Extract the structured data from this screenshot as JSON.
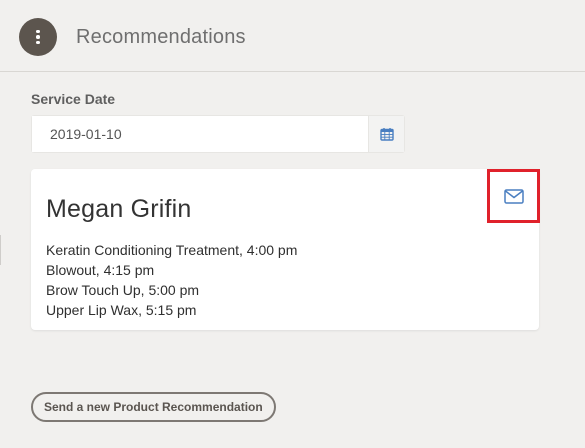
{
  "header": {
    "title": "Recommendations",
    "menu_icon": "vertical-ellipsis-icon"
  },
  "service_date": {
    "label": "Service Date",
    "value": "2019-01-10",
    "icon": "calendar-icon"
  },
  "card": {
    "client_name": "Megan Grifin",
    "email_icon": "envelope-icon",
    "services": [
      "Keratin Conditioning Treatment, 4:00 pm",
      "Blowout, 4:15 pm",
      "Brow Touch Up, 5:00 pm",
      "Upper Lip Wax, 5:15 pm"
    ]
  },
  "actions": {
    "new_recommendation_label": "Send a new Product Recommendation"
  },
  "colors": {
    "background": "#f1f0ee",
    "menu_button": "#5c554e",
    "accent_blue": "#4a7fc1",
    "highlight_red": "#e0212b"
  }
}
